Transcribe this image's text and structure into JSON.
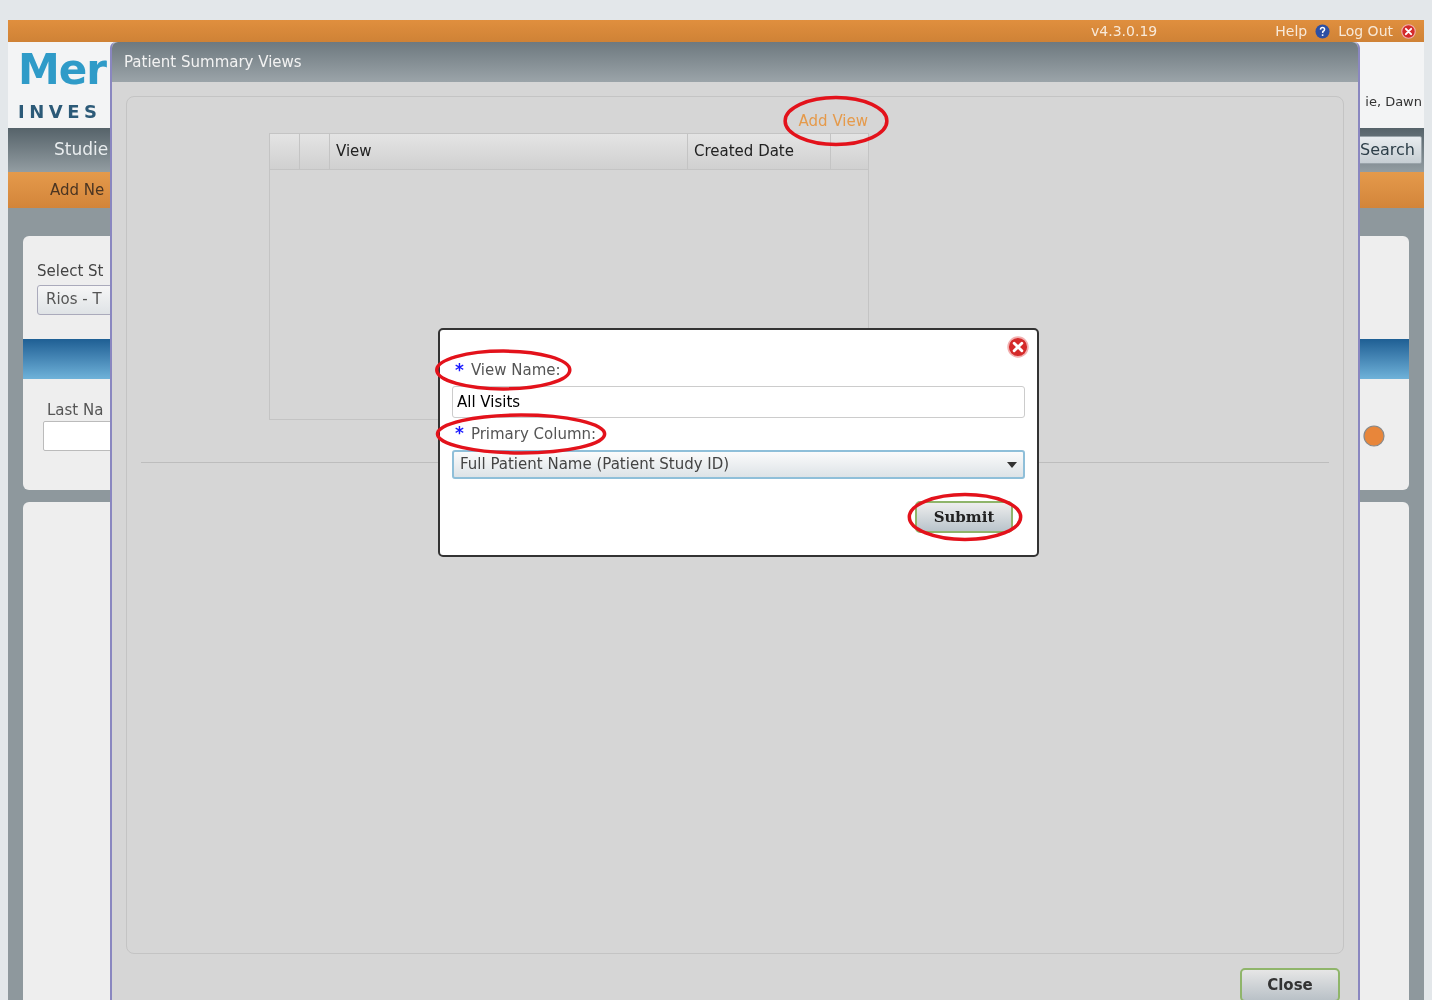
{
  "top_bar": {
    "version": "v4.3.0.19",
    "help": "Help",
    "logout": "Log Out"
  },
  "header": {
    "logo_word": "Mer",
    "logo_tagline": "INVES",
    "user": "ie, Dawn"
  },
  "nav": {
    "tab": "Studie",
    "search_button": "Search"
  },
  "subnav": {
    "link": "Add Ne"
  },
  "filter_card": {
    "select_label": "Select St",
    "select_value": "Rios - T",
    "last_name_label": "Last Na"
  },
  "window": {
    "title": "Patient Summary Views",
    "add_view": {
      "label": "Add View",
      "circled": true
    },
    "table": {
      "columns": [
        {
          "label": "View"
        },
        {
          "label": "Created Date"
        }
      ]
    },
    "close_button": "Close"
  },
  "form": {
    "fields": [
      {
        "kind": "text",
        "required_mark": "*",
        "label": "View Name:",
        "circled": true,
        "value": "All Visits"
      },
      {
        "kind": "select",
        "required_mark": "*",
        "label": "Primary Column:",
        "circled": true,
        "value": "Full Patient Name (Patient Study ID)"
      }
    ],
    "submit": {
      "label": "Submit",
      "circled": true
    }
  }
}
